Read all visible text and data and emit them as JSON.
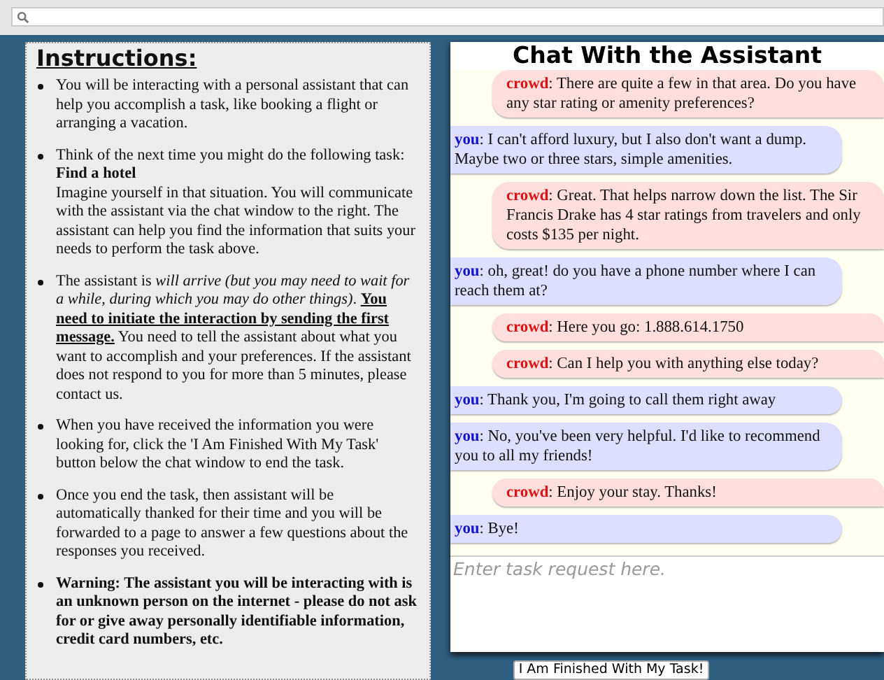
{
  "instructions": {
    "title": "Instructions:",
    "items": [
      {
        "segments": [
          {
            "kind": "plain",
            "text": "You will be interacting with a personal assistant that can help you accomplish a task, like booking a flight or arranging a vacation."
          }
        ]
      },
      {
        "segments": [
          {
            "kind": "plain",
            "text": "Think of the next time you might do the following task:"
          },
          {
            "kind": "bold-block",
            "text": "Find a hotel"
          },
          {
            "kind": "plain",
            "text": "Imagine yourself in that situation. You will communicate with the assistant via the chat window to the right. The assistant can help you find the information that suits your needs to perform the task above."
          }
        ]
      },
      {
        "segments": [
          {
            "kind": "plain",
            "text": "The assistant is "
          },
          {
            "kind": "italic",
            "text": "will arrive (but you may need to wait for a while, during which you may do other things)"
          },
          {
            "kind": "plain",
            "text": ". "
          },
          {
            "kind": "bold-underline",
            "text": "You need to initiate the interaction by sending the first message."
          },
          {
            "kind": "plain",
            "text": " You need to tell the assistant about what you want to accomplish and your preferences. If the assistant does not respond to you for more than 5 minutes, please contact us."
          }
        ]
      },
      {
        "segments": [
          {
            "kind": "plain",
            "text": "When you have received the information you were looking for, click the 'I Am Finished With My Task' button below the chat window to end the task."
          }
        ]
      },
      {
        "segments": [
          {
            "kind": "plain",
            "text": "Once you end the task, then assistant will be automatically thanked for their time and you will be forwarded to a page to answer a few questions about the responses you received."
          }
        ]
      },
      {
        "segments": [
          {
            "kind": "bold",
            "text": "Warning: The assistant you will be interacting with is an unknown person on the internet - please do not ask for or give away personally identifiable information, credit card numbers, etc."
          }
        ]
      }
    ]
  },
  "chat": {
    "title": "Chat With the Assistant",
    "messages": [
      {
        "kind": "crowd",
        "sender": "crowd",
        "text": ": There are quite a few in that area. Do you have any star rating or amenity preferences?"
      },
      {
        "kind": "you",
        "sender": "you",
        "text": ": I can't afford luxury, but I also don't want a dump. Maybe two or three stars, simple amenities."
      },
      {
        "kind": "crowd",
        "sender": "crowd",
        "text": ": Great. That helps narrow down the list. The Sir Francis Drake has 4 star ratings from travelers and only costs $135 per night."
      },
      {
        "kind": "you",
        "sender": "you",
        "text": ": oh, great! do you have a phone number where I can reach them at?"
      },
      {
        "kind": "crowd",
        "sender": "crowd",
        "text": ": Here you go: 1.888.614.1750"
      },
      {
        "kind": "crowd",
        "sender": "crowd",
        "text": ": Can I help you with anything else today?"
      },
      {
        "kind": "you",
        "sender": "you",
        "text": ": Thank you, I'm going to call them right away"
      },
      {
        "kind": "you",
        "sender": "you",
        "text": ": No, you've been very helpful. I'd like to recommend you to all my friends!"
      },
      {
        "kind": "crowd",
        "sender": "crowd",
        "text": ": Enjoy your stay. Thanks!"
      },
      {
        "kind": "you",
        "sender": "you",
        "text": ": Bye!"
      }
    ],
    "input": {
      "placeholder": "Enter task request here."
    },
    "finish_button": "I Am Finished With My Task!"
  }
}
